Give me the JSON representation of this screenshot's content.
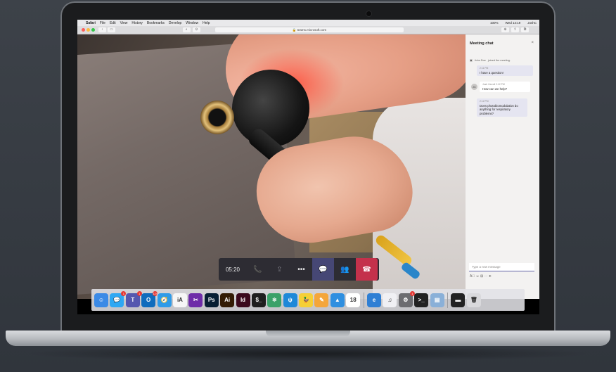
{
  "menubar": {
    "apple": "",
    "items": [
      "Safari",
      "File",
      "Edit",
      "View",
      "History",
      "Bookmarks",
      "Develop",
      "Window",
      "Help"
    ],
    "status": {
      "date": "Wed 14:19",
      "user": "JoshC",
      "battery": "100%"
    }
  },
  "browser": {
    "url": "🔒 teams.microsoft.com"
  },
  "call": {
    "timer": "05:20",
    "controls": {
      "call_icon": "📞",
      "share_icon": "⇪",
      "more_label": "•••",
      "chat_icon": "💬",
      "people_icon": "👥",
      "hangup_icon": "☎"
    }
  },
  "chat": {
    "title": "Meeting chat",
    "close": "×",
    "system_message": {
      "name": "John Doe",
      "text": "joined the meeting."
    },
    "messages": [
      {
        "meta": "2:11 PM",
        "text": "I have a question!",
        "side": "me"
      },
      {
        "meta": "Josh Carroll  2:12 PM",
        "text": "How can we help?",
        "side": "other",
        "avatar": "JC"
      },
      {
        "meta": "2:12 PM",
        "text": "Does photobiomodulation do anything for respiratory problems?",
        "side": "me"
      }
    ],
    "compose_placeholder": "Type a new message",
    "compose_icons": "A⃝  ☺  ⊞  ⋯                    ➤"
  },
  "dock": {
    "apps": [
      {
        "name": "Finder",
        "label": "☺",
        "color": "#3b8ae6"
      },
      {
        "name": "Messages",
        "label": "💬",
        "color": "#2ea8f3",
        "badge": "1"
      },
      {
        "name": "Teams",
        "label": "T",
        "color": "#5558af",
        "badge": "1"
      },
      {
        "name": "Outlook",
        "label": "O",
        "color": "#0f6cbd",
        "badge": "124"
      },
      {
        "name": "Safari",
        "label": "🧭",
        "color": "#2f9be8"
      },
      {
        "name": "iA Writer",
        "label": "iA",
        "color": "#f6f6f6",
        "dark": true
      },
      {
        "name": "Final Cut Pro",
        "label": "✂",
        "color": "#6e2ca8"
      },
      {
        "name": "Photoshop",
        "label": "Ps",
        "color": "#071e33"
      },
      {
        "name": "Illustrator",
        "label": "Ai",
        "color": "#331c05"
      },
      {
        "name": "InDesign",
        "label": "Id",
        "color": "#3b0a1d"
      },
      {
        "name": "Terminal",
        "label": "$_",
        "color": "#1e1e1e"
      },
      {
        "name": "Atom",
        "label": "⚛",
        "color": "#3aa168"
      },
      {
        "name": "Fork",
        "label": "ψ",
        "color": "#1f88d8"
      },
      {
        "name": "Cyberduck",
        "label": "🦆",
        "color": "#f5cf36"
      },
      {
        "name": "Pages",
        "label": "✎",
        "color": "#f4a63a"
      },
      {
        "name": "Keynote",
        "label": "▲",
        "color": "#2f8fe0"
      },
      {
        "name": "Calendar",
        "label": "18",
        "color": "#ffffff",
        "dark": true
      },
      {
        "sep": true
      },
      {
        "name": "Edge",
        "label": "e",
        "color": "#2f7fd4"
      },
      {
        "name": "iTunes",
        "label": "♫",
        "color": "#f0f0f4",
        "dark": true
      },
      {
        "name": "System Preferences",
        "label": "⚙",
        "color": "#6c6c70",
        "badge": "1"
      },
      {
        "name": "Terminal 2",
        "label": ">_",
        "color": "#222222"
      },
      {
        "name": "Preview",
        "label": "▤",
        "color": "#8ab0d8"
      },
      {
        "sep": true
      },
      {
        "name": "Screen",
        "label": "▬",
        "color": "#222222"
      },
      {
        "name": "Trash",
        "label": "🗑",
        "color": "#d9d9dc",
        "dark": true
      }
    ]
  }
}
